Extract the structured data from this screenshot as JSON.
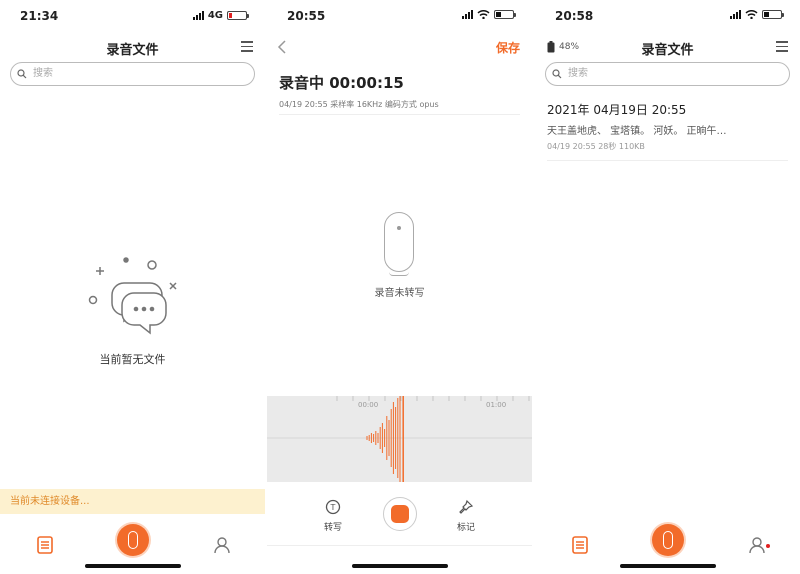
{
  "screen1": {
    "status": {
      "time": "21:34",
      "network": "4G"
    },
    "title": "录音文件",
    "search_placeholder": "搜索",
    "empty_text": "当前暂无文件",
    "banner": "当前未连接设备..."
  },
  "screen2": {
    "status": {
      "time": "20:55"
    },
    "save_label": "保存",
    "recording_title": "录音中 00:00:15",
    "meta": "04/19 20:55    采样率 16KHz 编码方式 opus",
    "mic_status": "录音未转写",
    "timeline": [
      "00:00",
      "01:00"
    ],
    "waveform": [
      4,
      6,
      10,
      8,
      14,
      10,
      22,
      30,
      18,
      44,
      36,
      58,
      72,
      62,
      80,
      90
    ],
    "controls": {
      "transcribe": "转写",
      "mark": "标记"
    }
  },
  "screen3": {
    "status": {
      "time": "20:58"
    },
    "device_battery": "48%",
    "title": "录音文件",
    "search_placeholder": "搜索",
    "files": [
      {
        "title": "2021年 04月19日 20:55",
        "snippet": "天王盖地虎、 宝塔镇。 河妖。 正晌午…",
        "meta": "04/19 20:55 28秒 110KB"
      }
    ]
  },
  "colors": {
    "accent": "#f26b2a",
    "banner_bg": "#fdf1cf",
    "banner_text": "#e08a2a",
    "wave_bg": "#eaeaea"
  }
}
